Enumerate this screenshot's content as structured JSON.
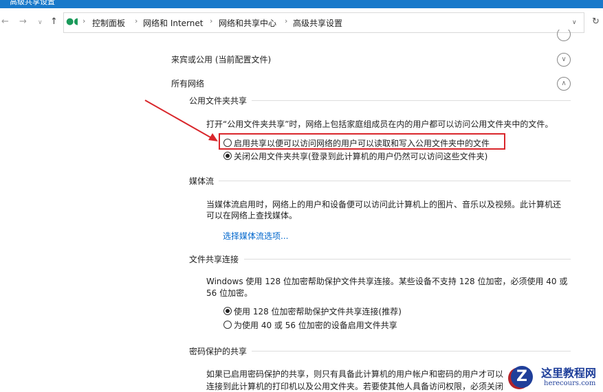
{
  "window": {
    "title": "高级共享设置"
  },
  "breadcrumb": [
    "控制面板",
    "网络和 Internet",
    "网络和共享中心",
    "高级共享设置"
  ],
  "sections": {
    "guest_public": "来宾或公用 (当前配置文件)",
    "all_networks": "所有网络"
  },
  "public_folder": {
    "title": "公用文件夹共享",
    "desc": "打开“公用文件夹共享”时，网络上包括家庭组成员在内的用户都可以访问公用文件夹中的文件。",
    "options": [
      "启用共享以便可以访问网络的用户可以读取和写入公用文件夹中的文件",
      "关闭公用文件夹共享(登录到此计算机的用户仍然可以访问这些文件夹)"
    ],
    "selected": 1
  },
  "media": {
    "title": "媒体流",
    "desc1": "当媒体流启用时，网络上的用户和设备便可以访问此计算机上的图片、音乐以及视频。此计算机还",
    "desc2": "可以在网络上查找媒体。",
    "link": "选择媒体流选项..."
  },
  "file_conn": {
    "title": "文件共享连接",
    "desc1": "Windows 使用 128 位加密帮助保护文件共享连接。某些设备不支持 128 位加密，必须使用 40 或",
    "desc2": "56 位加密。",
    "options": [
      "使用 128 位加密帮助保护文件共享连接(推荐)",
      "为使用 40 或 56 位加密的设备启用文件共享"
    ],
    "selected": 0
  },
  "password": {
    "title": "密码保护的共享",
    "desc1": "如果已启用密码保护的共享，则只有具备此计算机的用户帐户和密码的用户才可以",
    "desc2": "连接到此计算机的打印机以及公用文件夹。若要使其他人具备访问权限，必须关闭"
  },
  "watermark": {
    "name": "这里教程网",
    "url": "herecours.com"
  },
  "colors": {
    "highlight": "#d9262b",
    "link": "#0066cc",
    "titlebar": "#1979ca"
  }
}
